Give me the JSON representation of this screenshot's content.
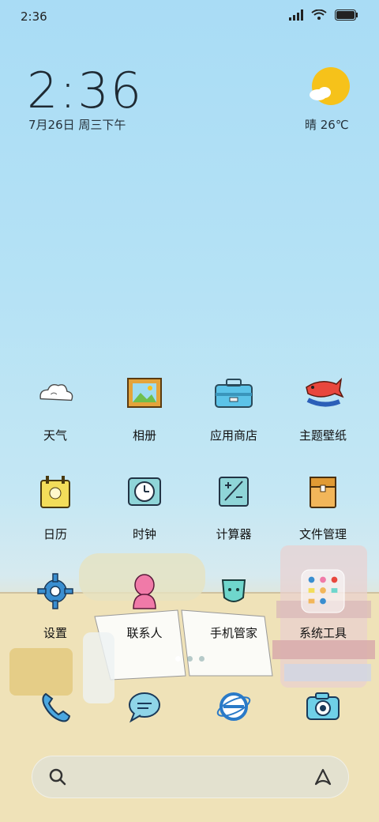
{
  "status_bar": {
    "time": "2:36"
  },
  "clock": {
    "time": "2:36",
    "date": "7月26日 周三下午"
  },
  "weather": {
    "text": "晴 26℃",
    "icon": "sunny-cloud-icon"
  },
  "apps": [
    {
      "label": "天气",
      "icon": "cloud-icon"
    },
    {
      "label": "相册",
      "icon": "picture-frame-icon"
    },
    {
      "label": "应用商店",
      "icon": "toolbox-icon"
    },
    {
      "label": "主题壁纸",
      "icon": "koi-fish-icon"
    },
    {
      "label": "日历",
      "icon": "calendar-icon"
    },
    {
      "label": "时钟",
      "icon": "clock-icon"
    },
    {
      "label": "计算器",
      "icon": "calculator-icon"
    },
    {
      "label": "文件管理",
      "icon": "folder-icon"
    },
    {
      "label": "设置",
      "icon": "gear-icon"
    },
    {
      "label": "联系人",
      "icon": "person-icon"
    },
    {
      "label": "手机管家",
      "icon": "shield-icon"
    },
    {
      "label": "系统工具",
      "icon": "tools-folder-icon"
    }
  ],
  "dock": [
    {
      "icon": "phone-icon"
    },
    {
      "icon": "message-icon"
    },
    {
      "icon": "browser-icon"
    },
    {
      "icon": "camera-icon"
    }
  ],
  "colors": {
    "sky_top": "#a9dcf5",
    "sand": "#f0e1b6",
    "sun": "#f6c21a"
  }
}
